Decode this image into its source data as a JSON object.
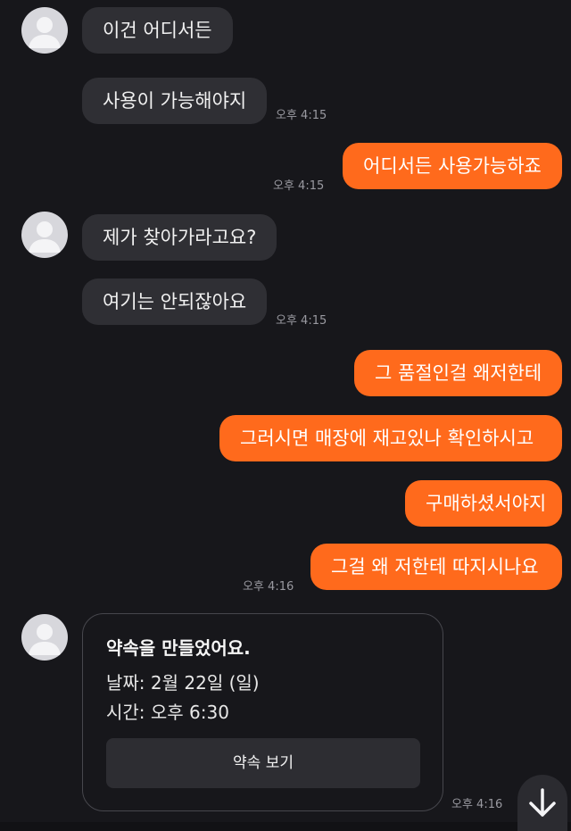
{
  "messages": [
    {
      "text": "이건 어디서든"
    },
    {
      "text": "사용이 가능해야지",
      "time": "오후 4:15"
    },
    {
      "text": "어디서든 사용가능하죠",
      "time": "오후 4:15"
    },
    {
      "text": "제가 찾아가라고요?"
    },
    {
      "text": "여기는 안되잖아요",
      "time": "오후 4:15"
    },
    {
      "text": "그 품절인걸 왜저한테"
    },
    {
      "text": "그러시면 매장에 재고있나 확인하시고"
    },
    {
      "text": "구매하셨서야지"
    },
    {
      "text": "그걸 왜 저한테 따지시나요",
      "time": "오후 4:16"
    }
  ],
  "appointment": {
    "title": "약속을 만들었어요.",
    "date_line": "날짜: 2월 22일 (일)",
    "time_line": "시간: 오후 6:30",
    "button_label": "약속 보기",
    "time": "오후 4:16"
  },
  "icons": {
    "avatar": "default-profile-avatar",
    "scroll": "arrow-down-icon"
  },
  "colors": {
    "outgoing_bubble": "#ff6a1c",
    "incoming_bubble": "#2f2f34",
    "background": "#17171b"
  }
}
